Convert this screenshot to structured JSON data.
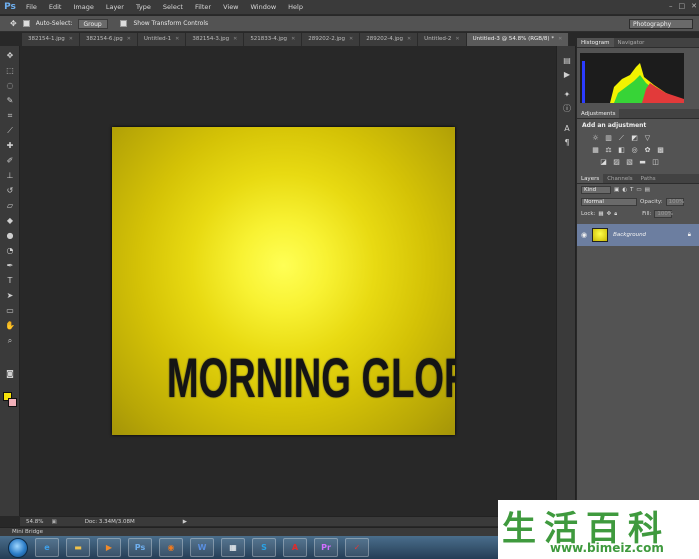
{
  "app": {
    "logo": "Ps"
  },
  "menu": [
    "File",
    "Edit",
    "Image",
    "Layer",
    "Type",
    "Select",
    "Filter",
    "View",
    "Window",
    "Help"
  ],
  "window_controls": {
    "minimize": "–",
    "maximize": "□",
    "close": "✕"
  },
  "options": {
    "auto_select_label": "Auto-Select:",
    "auto_select_value": "Group",
    "transform_label": "Show Transform Controls",
    "workspace": "Photography"
  },
  "tabs": [
    {
      "label": "382154-1.jpg"
    },
    {
      "label": "382154-6.jpg"
    },
    {
      "label": "Untitled-1"
    },
    {
      "label": "382154-3.jpg"
    },
    {
      "label": "521833-4.jpg"
    },
    {
      "label": "289202-2.jpg"
    },
    {
      "label": "289202-4.jpg"
    },
    {
      "label": "Untitled-2"
    },
    {
      "label": "Untitled-3 @ 54.8% (RGB/8) *"
    }
  ],
  "canvas": {
    "headline": "MORNING GLORY"
  },
  "status": {
    "zoom": "54.8%",
    "doc": "Doc: 3.34M/3.08M"
  },
  "minibridge": "Mini Bridge",
  "panels": {
    "histogram_tabs": [
      "Histogram",
      "Navigator"
    ],
    "adjustments_tab": "Adjustments",
    "adjustments_title": "Add an adjustment",
    "layers_tabs": [
      "Layers",
      "Channels",
      "Paths"
    ],
    "kind_label": "Kind",
    "blend_mode": "Normal",
    "opacity_label": "Opacity:",
    "opacity_value": "100%",
    "lock_label": "Lock:",
    "fill_label": "Fill:",
    "fill_value": "100%",
    "layer_name": "Background"
  },
  "taskbar": {
    "apps": [
      {
        "glyph": "e",
        "color": "#3ea0ea"
      },
      {
        "glyph": "▬",
        "color": "#f1c24a"
      },
      {
        "glyph": "▶",
        "color": "#f08a2a"
      },
      {
        "glyph": "Ps",
        "color": "#6fb0f0"
      },
      {
        "glyph": "◉",
        "color": "#f07a1f"
      },
      {
        "glyph": "W",
        "color": "#5a8fe0"
      },
      {
        "glyph": "▦",
        "color": "#ffffff"
      },
      {
        "glyph": "S",
        "color": "#2aa3e6"
      },
      {
        "glyph": "A",
        "color": "#e22b2b"
      },
      {
        "glyph": "Pr",
        "color": "#d070ff"
      },
      {
        "glyph": "✓",
        "color": "#e03a3a"
      }
    ]
  },
  "watermark": {
    "chars": "生活百科",
    "url": "www.bimeiz.com"
  },
  "colors": {
    "accent": "#6c7ea0",
    "foreground_swatch": "#f6e20a",
    "background_swatch": "#f2b0b9"
  }
}
